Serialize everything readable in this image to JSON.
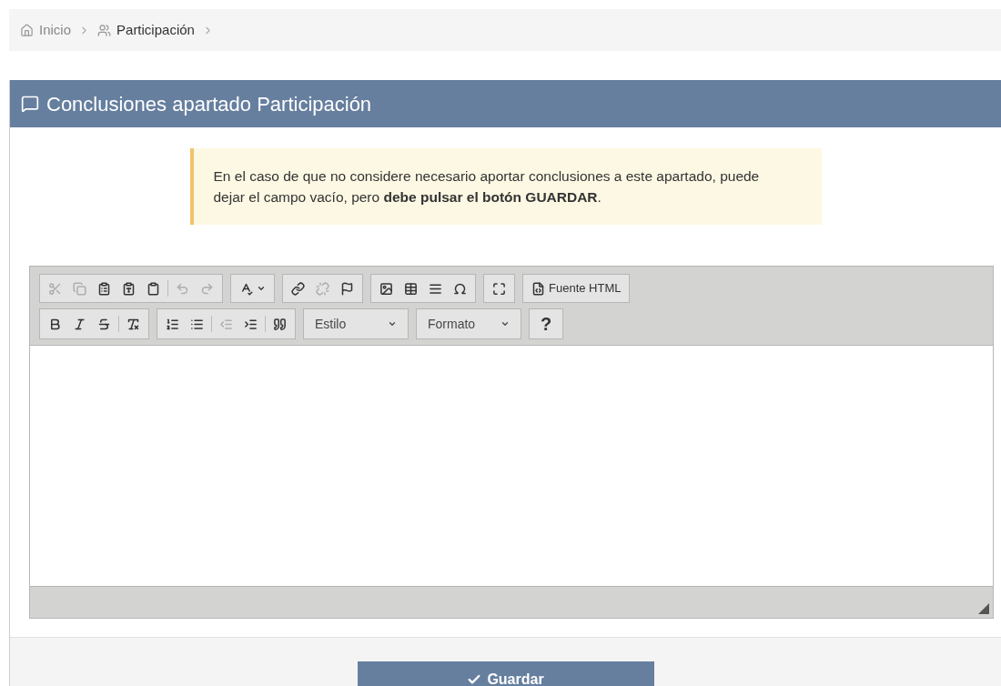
{
  "breadcrumb": [
    {
      "label": "Inicio",
      "current": false
    },
    {
      "label": "Participación",
      "current": true
    }
  ],
  "panel": {
    "title": "Conclusiones apartado Participación"
  },
  "alert": {
    "text": "En el caso de que no considere necesario aportar conclusiones a este apartado, puede dejar el campo vacío, pero **debe pulsar el botón GUARDAR**."
  },
  "toolbar_rows": [
    [
      [
        [
          {
            "disabled": true
          },
          {
            "disabled": true
          },
          {
            "disabled": false
          },
          {
            "disabled": false
          },
          {
            "disabled": false
          }
        ],
        [
          {
            "disabled": true
          },
          {
            "disabled": true
          }
        ]
      ],
      [
        [
          {
            "disabled": false
          }
        ]
      ],
      [
        [
          {
            "disabled": false
          },
          {
            "disabled": true
          },
          {
            "disabled": false
          }
        ]
      ],
      [
        [
          {
            "disabled": false
          },
          {
            "disabled": false
          },
          {
            "disabled": false
          },
          {
            "disabled": false
          }
        ]
      ],
      [
        [
          {
            "disabled": false
          }
        ]
      ],
      [
        [
          {
            "disabled": false,
            "label": "Fuente HTML"
          }
        ]
      ]
    ],
    [
      [
        [
          {
            "disabled": false
          },
          {
            "disabled": false
          },
          {
            "disabled": false
          }
        ],
        [
          {
            "disabled": false
          }
        ]
      ],
      [
        [
          {
            "disabled": false
          },
          {
            "disabled": false
          }
        ],
        [
          {
            "disabled": true
          },
          {
            "disabled": false
          }
        ],
        [
          {
            "disabled": false
          }
        ]
      ]
    ]
  ],
  "combos": [
    {
      "label": "Estilo"
    },
    {
      "label": "Formato"
    }
  ],
  "help_button": {
    "label": "?"
  },
  "save_button": {
    "label": "Guardar"
  }
}
